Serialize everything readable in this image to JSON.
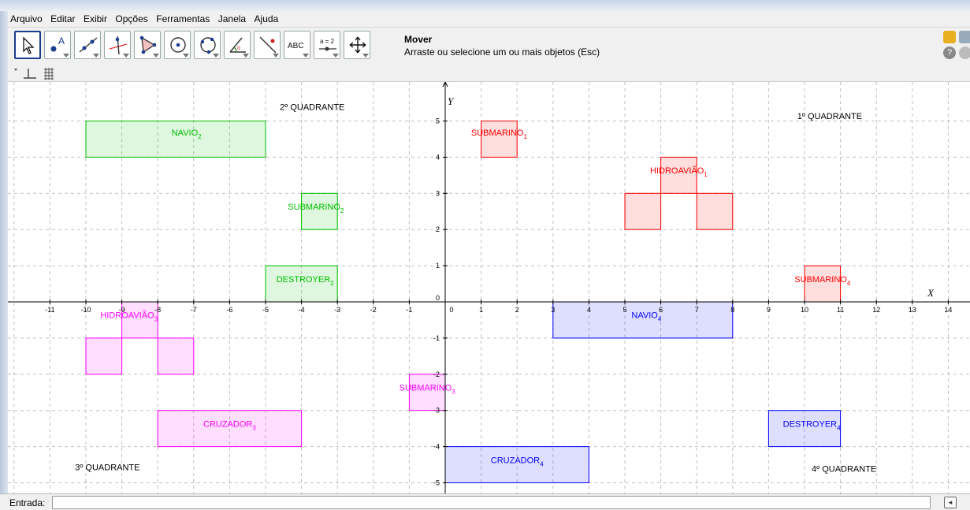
{
  "menu": [
    "Arquivo",
    "Editar",
    "Exibir",
    "Opções",
    "Ferramentas",
    "Janela",
    "Ajuda"
  ],
  "toolbar": {
    "tools": [
      {
        "name": "move-tool",
        "icon": "arrow-cursor-icon",
        "selected": true
      },
      {
        "name": "point-tool",
        "icon": "point-a-icon"
      },
      {
        "name": "line-tool",
        "icon": "line-through-points-icon"
      },
      {
        "name": "perpendicular-tool",
        "icon": "perpendicular-line-icon"
      },
      {
        "name": "polygon-tool",
        "icon": "polygon-icon"
      },
      {
        "name": "circle-tool",
        "icon": "circle-center-point-icon"
      },
      {
        "name": "conic-tool",
        "icon": "circle-three-points-icon"
      },
      {
        "name": "angle-tool",
        "icon": "angle-icon"
      },
      {
        "name": "reflect-tool",
        "icon": "reflect-about-line-icon"
      },
      {
        "name": "text-tool",
        "icon": "text-abc-icon",
        "label": "ABC"
      },
      {
        "name": "slider-tool",
        "icon": "slider-icon",
        "label": "a = 2"
      },
      {
        "name": "move-graphics-tool",
        "icon": "move-view-icon"
      }
    ],
    "active_tool_name": "Mover",
    "active_tool_help": "Arraste ou selecione um ou mais objetos (Esc)"
  },
  "stylebar": {
    "icons": [
      "axes-toggle-icon",
      "grid-toggle-icon"
    ]
  },
  "input": {
    "label": "Entrada:",
    "value": "",
    "button_icon": "input-help-icon"
  },
  "colors": {
    "red": "#ff0000",
    "green": "#00c000",
    "blue": "#0000ff",
    "magenta": "#ff00ff",
    "grid": "#c0c0c0"
  },
  "chart_data": {
    "type": "scatter",
    "xlabel": "X",
    "ylabel": "Y",
    "xlim": [
      -12,
      14.5
    ],
    "ylim": [
      -5.3,
      5.6
    ],
    "grid": true,
    "x_ticks": [
      -11,
      -10,
      -9,
      -8,
      -7,
      -6,
      -5,
      -4,
      -3,
      -2,
      -1,
      0,
      1,
      2,
      3,
      4,
      5,
      6,
      7,
      8,
      9,
      10,
      11,
      12,
      13,
      14
    ],
    "y_ticks": [
      -5,
      -4,
      -3,
      -2,
      -1,
      0,
      1,
      2,
      3,
      4,
      5
    ],
    "quadrant_labels": [
      {
        "text": "1º QUADRANTE",
        "x": 10.7,
        "y": 5.05
      },
      {
        "text": "2º QUADRANTE",
        "x": -3.7,
        "y": 5.3
      },
      {
        "text": "3º QUADRANTE",
        "x": -9.4,
        "y": -4.65
      },
      {
        "text": "4º QUADRANTE",
        "x": 11.1,
        "y": -4.7
      }
    ],
    "shapes": [
      {
        "name": "SUBMARINO",
        "sub": "1",
        "color": "red",
        "rects": [
          [
            1,
            4,
            2,
            5
          ]
        ],
        "lx": 1.5,
        "ly": 4.6
      },
      {
        "name": "HIDROAVIÃO",
        "sub": "1",
        "color": "red",
        "rects": [
          [
            5,
            2,
            6,
            3
          ],
          [
            6,
            3,
            7,
            4
          ],
          [
            7,
            2,
            8,
            3
          ]
        ],
        "lx": 6.5,
        "ly": 3.55
      },
      {
        "name": "SUBMARINO",
        "sub": "4",
        "color": "red",
        "rects": [
          [
            10,
            0,
            11,
            1
          ]
        ],
        "lx": 10.5,
        "ly": 0.55
      },
      {
        "name": "NAVIO",
        "sub": "2",
        "color": "green",
        "rects": [
          [
            -10,
            4,
            -5,
            5
          ]
        ],
        "lx": -7.2,
        "ly": 4.6
      },
      {
        "name": "SUBMARINO",
        "sub": "2",
        "color": "green",
        "rects": [
          [
            -4,
            2,
            -3,
            3
          ]
        ],
        "lx": -3.6,
        "ly": 2.55
      },
      {
        "name": "DESTROYER",
        "sub": "2",
        "color": "green",
        "rects": [
          [
            -5,
            0,
            -3,
            1
          ]
        ],
        "lx": -3.9,
        "ly": 0.55
      },
      {
        "name": "HIDROAVIÃO",
        "sub": "3",
        "color": "magenta",
        "rects": [
          [
            -9,
            -1,
            -8,
            0
          ],
          [
            -10,
            -2,
            -9,
            -1
          ],
          [
            -8,
            -2,
            -7,
            -1
          ]
        ],
        "lx": -8.8,
        "ly": -0.45
      },
      {
        "name": "SUBMARINO",
        "sub": "3",
        "color": "magenta",
        "rects": [
          [
            -1,
            -3,
            0,
            -2
          ]
        ],
        "lx": -0.5,
        "ly": -2.45
      },
      {
        "name": "CRUZADOR",
        "sub": "3",
        "color": "magenta",
        "rects": [
          [
            -8,
            -4,
            -4,
            -3
          ]
        ],
        "lx": -6.0,
        "ly": -3.45
      },
      {
        "name": "NAVIO",
        "sub": "4",
        "color": "blue",
        "rects": [
          [
            3,
            -1,
            8,
            0
          ]
        ],
        "lx": 5.6,
        "ly": -0.45
      },
      {
        "name": "DESTROYER",
        "sub": "4",
        "color": "blue",
        "rects": [
          [
            9,
            -4,
            11,
            -3
          ]
        ],
        "lx": 10.2,
        "ly": -3.45
      },
      {
        "name": "CRUZADOR",
        "sub": "4",
        "color": "blue",
        "rects": [
          [
            0,
            -5,
            4,
            -4
          ]
        ],
        "lx": 2.0,
        "ly": -4.45
      }
    ]
  }
}
